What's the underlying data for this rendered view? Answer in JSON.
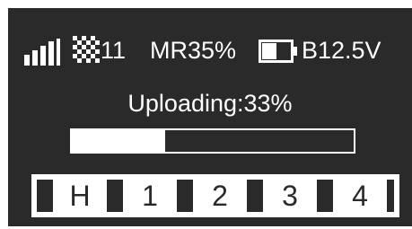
{
  "status": {
    "signal_icon": "signal-strength-icon",
    "satellite_icon": "checkerboard-satellite-icon",
    "satellite_count": "11",
    "mr_text": "MR35%",
    "battery_icon": "battery-icon",
    "battery_text": "B12.5V"
  },
  "upload": {
    "label": "Uploading:33%",
    "progress": 0.33
  },
  "channels": [
    "H",
    "1",
    "2",
    "3",
    "4"
  ],
  "colors": {
    "background": "#2a2a2a",
    "foreground": "#ffffff"
  }
}
